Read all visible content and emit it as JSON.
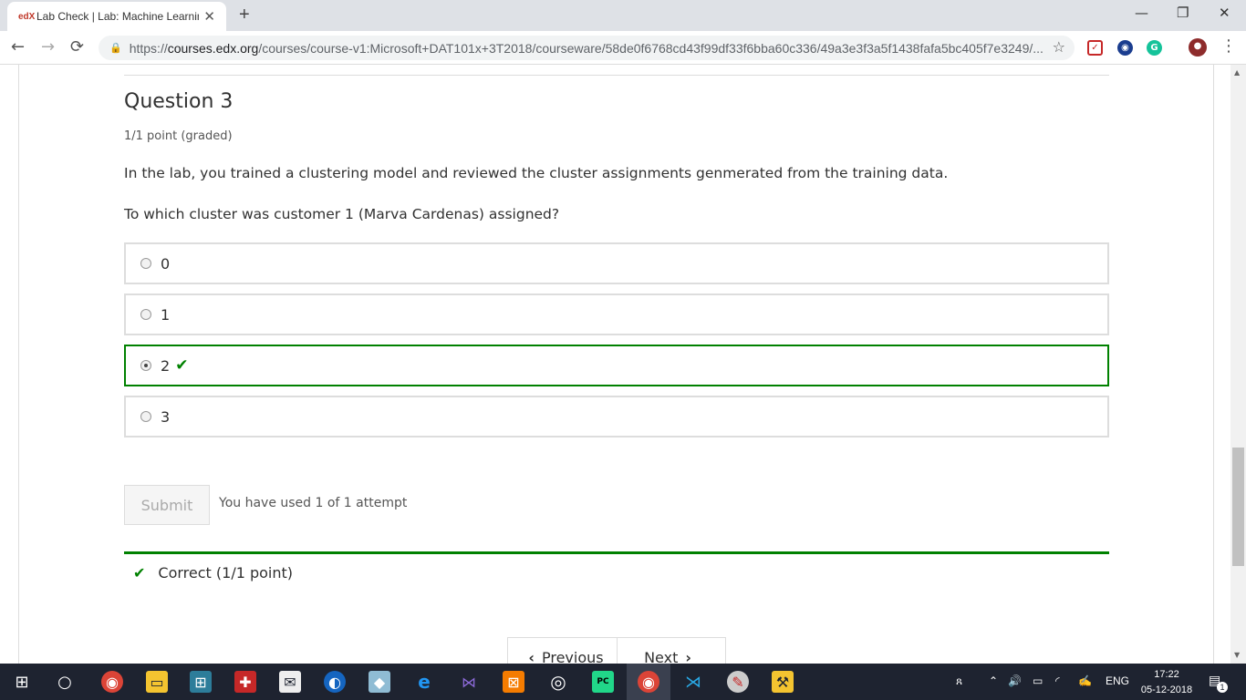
{
  "browser": {
    "tab_favicon": "edX",
    "tab_title": "Lab Check | Lab: Machine Learnin",
    "tab_close": "✕",
    "new_tab": "+",
    "window_controls": {
      "minimize": "—",
      "restore": "❐",
      "close": "✕"
    },
    "url_scheme": "https://",
    "url_host": "courses.edx.org",
    "url_path": "/courses/course-v1:Microsoft+DAT101x+3T2018/courseware/58de0f6768cd43f99df33f6bba60c336/49a3e3f3a5f1438fafa5bc405f7e3249/...",
    "extension_g_label": "G"
  },
  "question": {
    "title": "Question 3",
    "points": "1/1 point (graded)",
    "text": "In the lab, you trained a clustering model and reviewed the cluster assignments genmerated from the training data.",
    "prompt": "To which cluster was customer 1 (Marva Cardenas) assigned?",
    "options": [
      {
        "label": "0"
      },
      {
        "label": "1"
      },
      {
        "label": "2"
      },
      {
        "label": "3"
      }
    ],
    "selected_index": 2
  },
  "submit": {
    "label": "Submit",
    "attempts": "You have used 1 of 1 attempt"
  },
  "result": {
    "text": "Correct (1/1 point)"
  },
  "sequence_nav": {
    "previous": "Previous",
    "next": "Next"
  },
  "taskbar": {
    "language": "ENG",
    "time": "17:22",
    "date": "05-12-2018",
    "notification_count": "1"
  },
  "colors": {
    "correct": "#008100",
    "taskbar": "#1e2330"
  }
}
